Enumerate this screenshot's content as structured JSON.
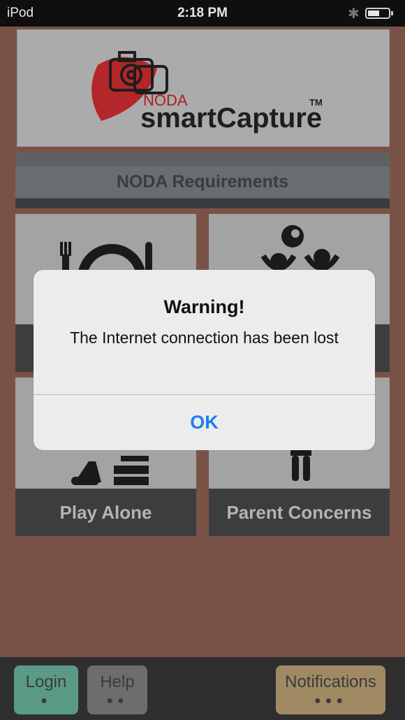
{
  "status_bar": {
    "carrier": "iPod",
    "time": "2:18 PM"
  },
  "logo": {
    "brand_small": "NODA",
    "brand_name": "smartCapture",
    "trademark": "TM"
  },
  "requirements_button": {
    "label": "NODA Requirements"
  },
  "tiles": [
    {
      "label": "",
      "icon": "meal-icon"
    },
    {
      "label": "",
      "icon": "play-together-icon"
    },
    {
      "label": "Play Alone",
      "icon": "play-alone-icon"
    },
    {
      "label": "Parent Concerns",
      "icon": "parent-icon"
    }
  ],
  "tabbar": {
    "login": {
      "label": "Login",
      "dots": "●"
    },
    "help": {
      "label": "Help",
      "dots": "●●"
    },
    "notifications": {
      "label": "Notifications",
      "dots": "●●●"
    }
  },
  "dialog": {
    "title": "Warning!",
    "message": "The Internet connection has been lost",
    "ok_label": "OK"
  },
  "colors": {
    "background": "#7a5147",
    "login_tab": "#5a9a86",
    "help_tab": "#6d6d6d",
    "notifications_tab": "#a08a63",
    "dialog_ok": "#1a7ef2"
  }
}
